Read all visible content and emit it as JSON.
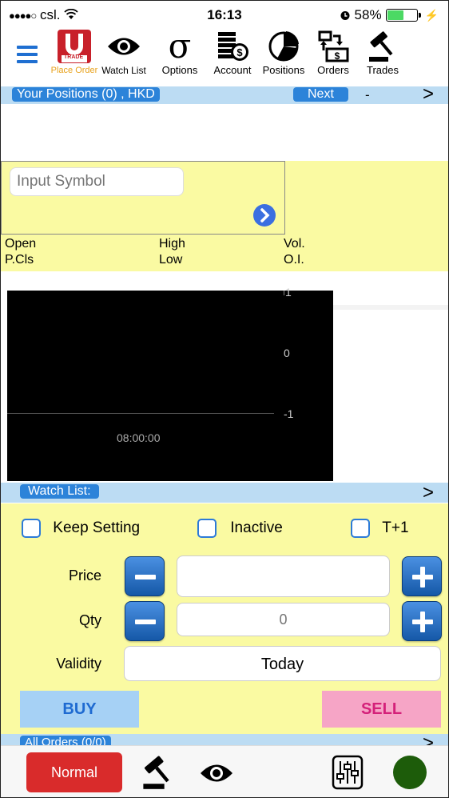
{
  "status_bar": {
    "signal": "●●●●○",
    "carrier": "csl.",
    "time": "16:13",
    "battery_percent": "58%",
    "battery_level": 0.58
  },
  "toolbar": {
    "logo_text": "TRADE",
    "items": [
      {
        "label": "Place Order",
        "icon": "trade-logo-icon"
      },
      {
        "label": "Watch List",
        "icon": "eye-icon"
      },
      {
        "label": "Options",
        "icon": "sigma-icon"
      },
      {
        "label": "Account",
        "icon": "money-stack-icon"
      },
      {
        "label": "Positions",
        "icon": "pie-chart-icon"
      },
      {
        "label": "Orders",
        "icon": "orders-icon"
      },
      {
        "label": "Trades",
        "icon": "gavel-icon"
      }
    ],
    "accent": "#1f6fd1",
    "place_order_color": "#e8a21c"
  },
  "positions_header": {
    "title": "Your Positions (0) , HKD",
    "next_label": "Next",
    "dash": "-",
    "chevron": ">"
  },
  "quote": {
    "symbol_placeholder": "Input Symbol",
    "labels": {
      "open": "Open",
      "high": "High",
      "vol": "Vol.",
      "pcls": "P.Cls",
      "low": "Low",
      "oi": "O.I."
    }
  },
  "chart": {
    "y_ticks": [
      "1",
      "0",
      "-1"
    ],
    "x_tick": "08:00:00"
  },
  "watchlist_header": {
    "title": "Watch List:",
    "chevron": ">"
  },
  "order_form": {
    "keep_setting": "Keep Setting",
    "inactive": "Inactive",
    "t_plus_1": "T+1",
    "price_label": "Price",
    "price_value": "",
    "qty_label": "Qty",
    "qty_placeholder": "0",
    "validity_label": "Validity",
    "validity_value": "Today",
    "buy_label": "BUY",
    "sell_label": "SELL",
    "buy_color": "#a6d1f5",
    "sell_color": "#f6a5c6"
  },
  "orders_header": {
    "title": "All Orders (0/0)",
    "chevron": ">"
  },
  "bottom_bar": {
    "normal_label": "Normal",
    "normal_color": "#d92b2b",
    "status_color": "#1d5c0a"
  }
}
